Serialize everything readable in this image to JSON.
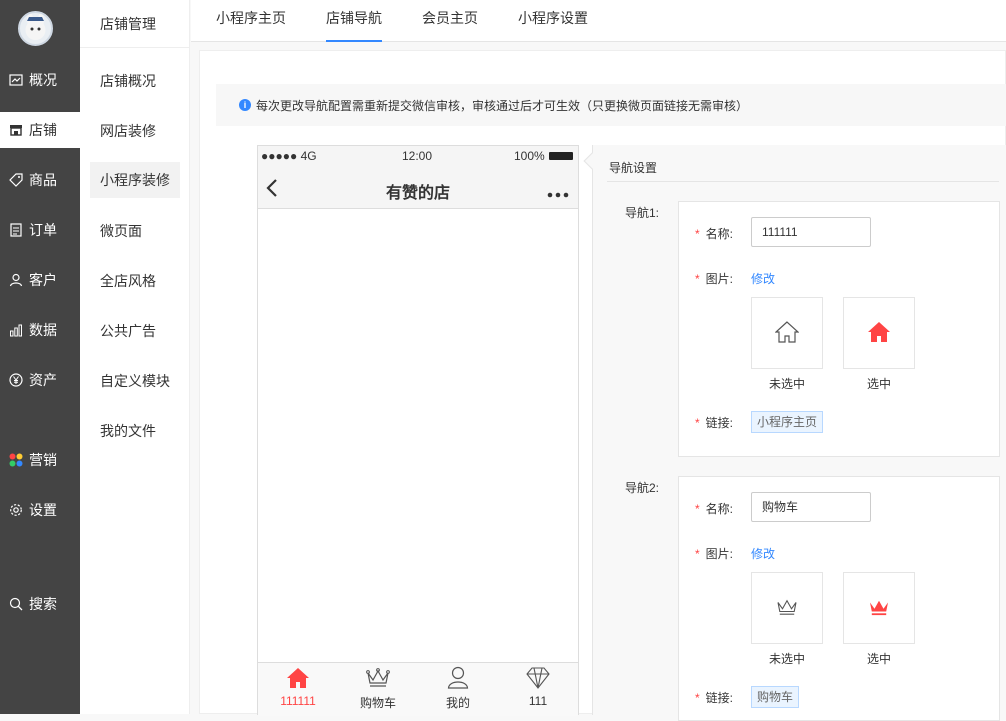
{
  "sidebar": {
    "items": [
      {
        "label": "概况",
        "icon": "dashboard-icon"
      },
      {
        "label": "店铺",
        "icon": "store-icon"
      },
      {
        "label": "商品",
        "icon": "tag-icon"
      },
      {
        "label": "订单",
        "icon": "order-icon"
      },
      {
        "label": "客户",
        "icon": "user-icon"
      },
      {
        "label": "数据",
        "icon": "bar-chart-icon"
      },
      {
        "label": "资产",
        "icon": "yen-icon"
      },
      {
        "label": "营销",
        "icon": "marketing-icon"
      },
      {
        "label": "设置",
        "icon": "gear-icon"
      },
      {
        "label": "搜索",
        "icon": "search-icon"
      }
    ]
  },
  "subnav": {
    "title": "店铺管理",
    "items": [
      "店铺概况",
      "网店装修",
      "小程序装修",
      "微页面",
      "全店风格",
      "公共广告",
      "自定义模块",
      "我的文件"
    ]
  },
  "tabs": [
    "小程序主页",
    "店铺导航",
    "会员主页",
    "小程序设置"
  ],
  "notice": "每次更改导航配置需重新提交微信审核，审核通过后才可生效（只更换微页面链接无需审核）",
  "phone": {
    "signal": "●●●●● 4G",
    "time": "12:00",
    "battery": "100%",
    "title": "有赞的店",
    "tabbar": [
      "111111",
      "购物车",
      "我的",
      "111"
    ]
  },
  "settings": {
    "title": "导航设置",
    "navs": [
      {
        "label": "导航1:",
        "name_label": "名称:",
        "name_value": "111111",
        "image_label": "图片:",
        "modify": "修改",
        "unselected": "未选中",
        "selected": "选中",
        "link_label": "链接:",
        "link_value": "小程序主页"
      },
      {
        "label": "导航2:",
        "name_label": "名称:",
        "name_value": "购物车",
        "image_label": "图片:",
        "modify": "修改",
        "unselected": "未选中",
        "selected": "选中",
        "link_label": "链接:",
        "link_value": "购物车"
      }
    ]
  },
  "colors": {
    "accent": "#3388ff",
    "active_red": "#f44444",
    "sidebar_bg": "#444444"
  }
}
